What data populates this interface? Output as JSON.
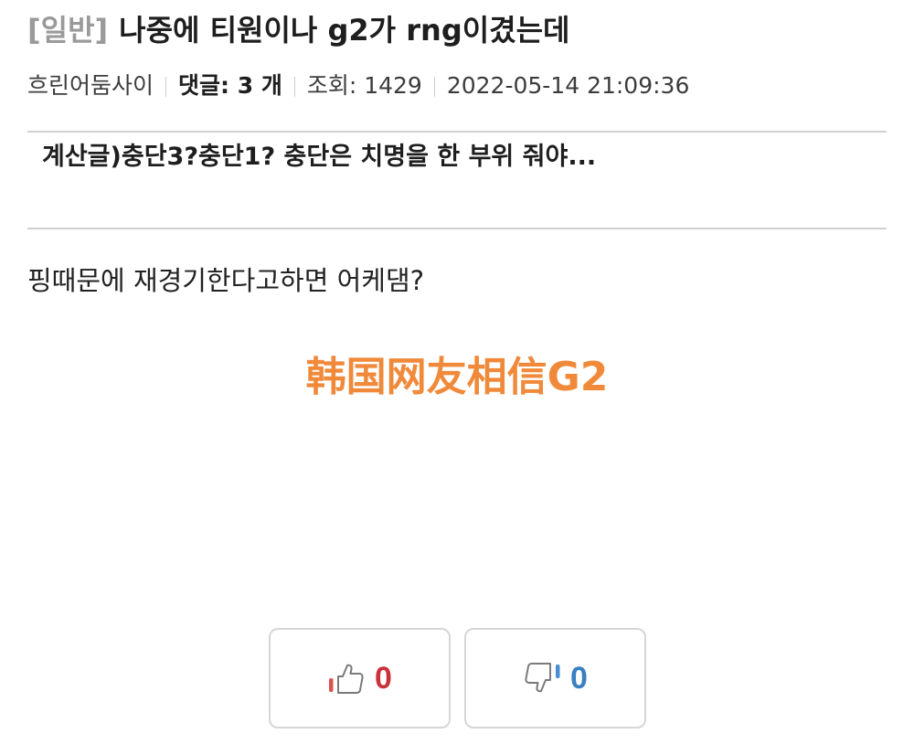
{
  "post": {
    "category": "[일반]",
    "title": "나중에 티원이나 g2가 rng이겼는데",
    "author": "흐린어둠사이",
    "comments": "댓글: 3 개",
    "views": "조회: 1429",
    "datetime": "2022-05-14 21:09:36"
  },
  "related": {
    "link_text": "계산글)충단3?충단1? 충단은 치명을 한 부위 줘야..."
  },
  "content": {
    "body_text": "핑때문에 재경기한다고하면 어케댐?",
    "caption": "韩国网友相信G2"
  },
  "votes": {
    "up_count": "0",
    "down_count": "0"
  },
  "colors": {
    "caption": "#f08a3a",
    "upvote": "#c9323a",
    "downvote": "#3a7fc1",
    "category": "#9a9a9a"
  },
  "icons": {
    "upvote": "thumbs-up-icon",
    "downvote": "thumbs-down-icon"
  }
}
